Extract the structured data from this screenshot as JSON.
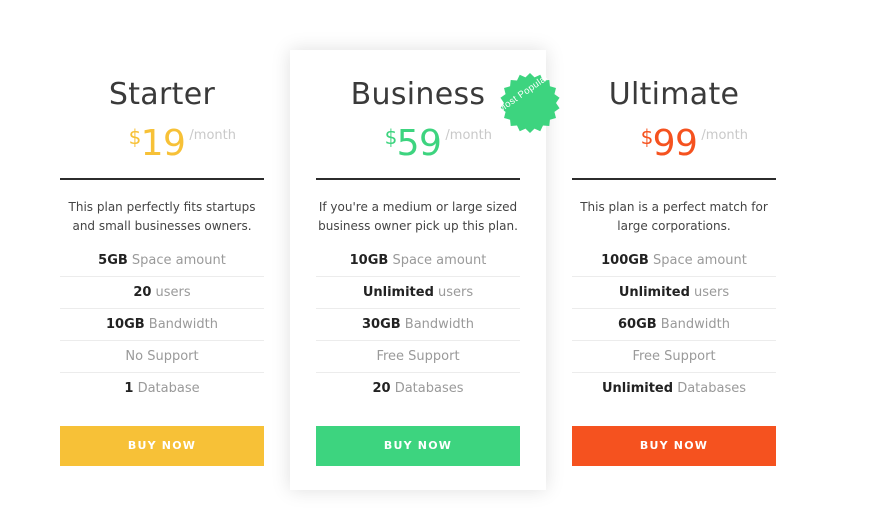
{
  "plans": [
    {
      "title": "Starter",
      "currency": "$",
      "amount": "19",
      "period": "/month",
      "accent": "#f7c137",
      "description": "This plan perfectly fits startups and small businesses owners.",
      "features": [
        {
          "bold": "5GB",
          "text": "Space amount"
        },
        {
          "bold": "20",
          "text": "users"
        },
        {
          "bold": "10GB",
          "text": "Bandwidth"
        },
        {
          "bold": "",
          "text": "No Support"
        },
        {
          "bold": "1",
          "text": "Database"
        }
      ],
      "button": "BUY NOW"
    },
    {
      "title": "Business",
      "currency": "$",
      "amount": "59",
      "period": "/month",
      "accent": "#3dd47f",
      "description": "If you're a medium or large sized business owner pick up this plan.",
      "features": [
        {
          "bold": "10GB",
          "text": "Space amount"
        },
        {
          "bold": "Unlimited",
          "text": "users"
        },
        {
          "bold": "30GB",
          "text": "Bandwidth"
        },
        {
          "bold": "",
          "text": "Free Support"
        },
        {
          "bold": "20",
          "text": "Databases"
        }
      ],
      "button": "BUY NOW",
      "badge": "Most Popular",
      "badge_color": "#3dd47f"
    },
    {
      "title": "Ultimate",
      "currency": "$",
      "amount": "99",
      "period": "/month",
      "accent": "#f5521f",
      "description": "This plan is a perfect match for large corporations.",
      "features": [
        {
          "bold": "100GB",
          "text": "Space amount"
        },
        {
          "bold": "Unlimited",
          "text": "users"
        },
        {
          "bold": "60GB",
          "text": "Bandwidth"
        },
        {
          "bold": "",
          "text": "Free Support"
        },
        {
          "bold": "Unlimited",
          "text": "Databases"
        }
      ],
      "button": "BUY NOW"
    }
  ]
}
